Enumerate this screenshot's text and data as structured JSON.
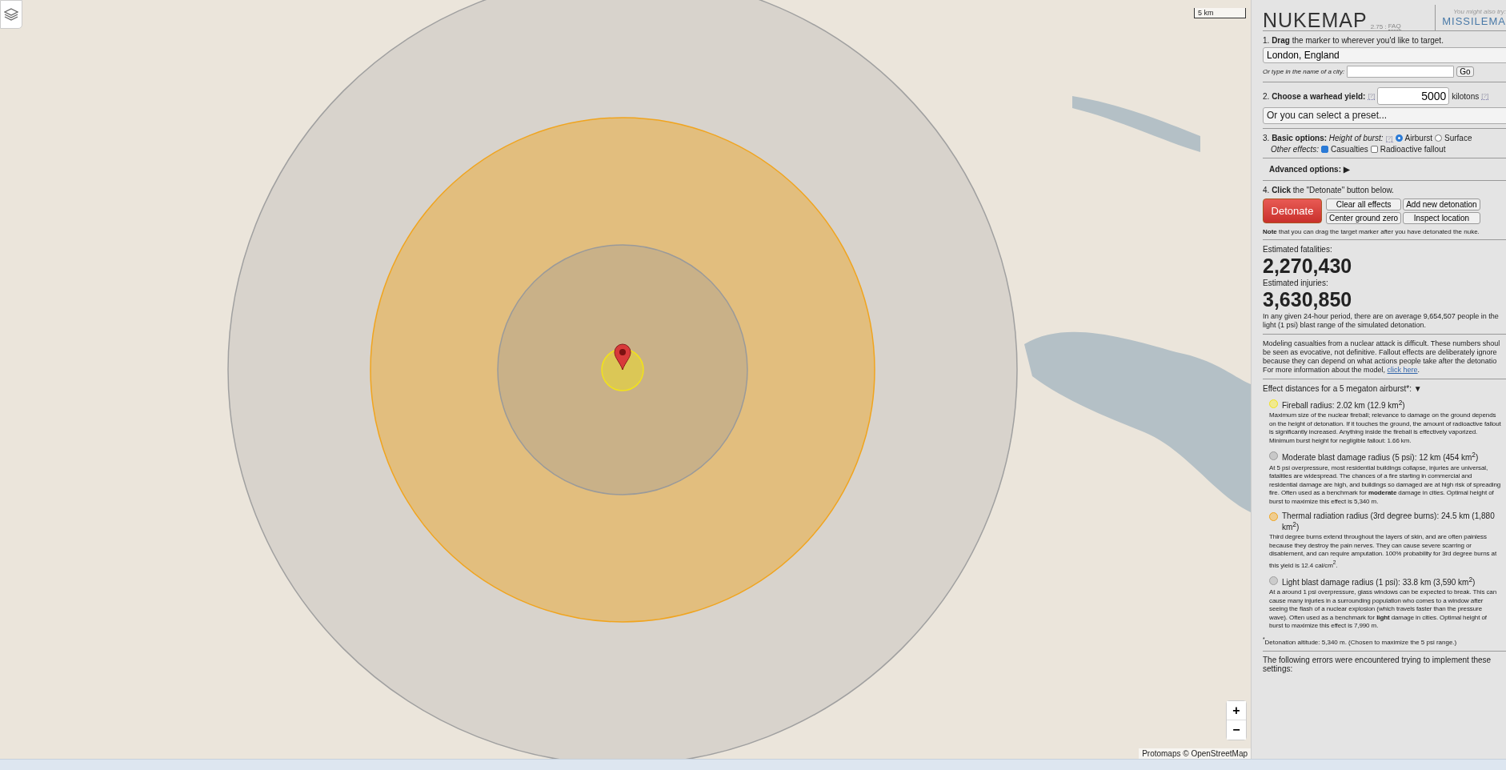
{
  "map": {
    "scale": "5 km",
    "zoom_in": "+",
    "zoom_out": "−",
    "attribution": "Protomaps © OpenStreetMap"
  },
  "sidebar": {
    "header": {
      "title": "NUKEMAP",
      "version": "2.75 :",
      "faq": "FAQ",
      "also_try": "You might also try:",
      "other_site": "MISSILEMA"
    },
    "step1": {
      "text": "1. **Drag** the marker to wherever you'd like to target.",
      "location": "London, England",
      "city_label": "Or type in the name of a city:",
      "go": "Go"
    },
    "step2": {
      "text": "2. **Choose a warhead yield:**",
      "help": "[?]",
      "yield": "5000",
      "unit": "kilotons",
      "unit_help": "[?]",
      "preset": "Or you can select a preset..."
    },
    "step3": {
      "label": "3. **Basic options:** *Height of burst:*",
      "help": "[?]",
      "burst": [
        {
          "label": "Airburst",
          "selected": true
        },
        {
          "label": "Surface",
          "selected": false
        }
      ],
      "other_label": "Other effects:",
      "effects": [
        {
          "label": "Casualties",
          "checked": true
        },
        {
          "label": "Radioactive fallout",
          "checked": false
        }
      ]
    },
    "advanced": {
      "label": "Advanced options:",
      "toggle": "▶"
    },
    "step4": {
      "text": "4. **Click** the \"Detonate\" button below.",
      "detonate": "Detonate",
      "buttons": [
        "Clear all effects",
        "Add new detonation",
        "Center ground zero",
        "Inspect location"
      ],
      "note": "**Note** that you can drag the target marker after you have detonated the nuke."
    },
    "results": {
      "fatalities_label": "Estimated fatalities:",
      "fatalities": "2,270,430",
      "injuries_label": "Estimated injuries:",
      "injuries": "3,630,850",
      "summary": "In any given 24-hour period, there are on average 9,654,507 people in the light (1 psi) blast range of the simulated detonation."
    },
    "modeling": {
      "text": "Modeling casualties from a nuclear attack is difficult. These numbers shoul be seen as evocative, not definitive. Fallout effects are deliberately ignore because they can depend on what actions people take after the detonatio For more information about the model,",
      "link": "click here",
      "end": "."
    },
    "effects_heading": "Effect distances for a 5 megaton airburst*:",
    "effects_toggle": "▼",
    "effects": [
      {
        "color": "#f2e21a",
        "title": "Fireball radius: 2.02 km (12.9 km$^{2}$)",
        "desc": "Maximum size of the nuclear fireball; relevance to damage on the ground depends on the height of detonation. If it touches the ground, the amount of radioactive fallout is significantly increased. Anything inside the fireball is effectively vaporized. Minimum burst height for negligible fallout: 1.66 km."
      },
      {
        "color": "#9a9a9a",
        "title": "Moderate blast damage radius (5 psi): 12 km (454 km$^{2}$)",
        "desc": "At 5 psi overpressure, most residential buildings collapse, injuries are universal, fatalities are widespread. The chances of a fire starting in commercial and residential damage are high, and buildings so damaged are at high risk of spreading fire. Often used as a benchmark for **moderate** damage in cities. Optimal height of burst to maximize this effect is 5,340 m."
      },
      {
        "color": "#f0a41e",
        "title": "Thermal radiation radius (3rd degree burns): 24.5 km (1,880 km$^{2}$)",
        "desc": "Third degree burns extend throughout the layers of skin, and are often painless because they destroy the pain nerves. They can cause severe scarring or disablement, and can require amputation. 100% probability for 3rd degree burns at this yield is 12.4 cal/cm$^{2}$."
      },
      {
        "color": "#a0a0a0",
        "title": "Light blast damage radius (1 psi): 33.8 km (3,590 km$^{2}$)",
        "desc": "At a around 1 psi overpressure, glass windows can be expected to break. This can cause many injuries in a surrounding population who comes to a window after seeing the flash of a nuclear explosion (which travels faster than the pressure wave). Often used as a benchmark for **light** damage in cities. Optimal height of burst to maximize this effect is 7,990 m."
      }
    ],
    "footnote": "$^{*}$Detonation altitude: 5,340 m. (Chosen to maximize the 5 psi range.)",
    "errors": "The following errors were encountered trying to implement these settings:"
  }
}
